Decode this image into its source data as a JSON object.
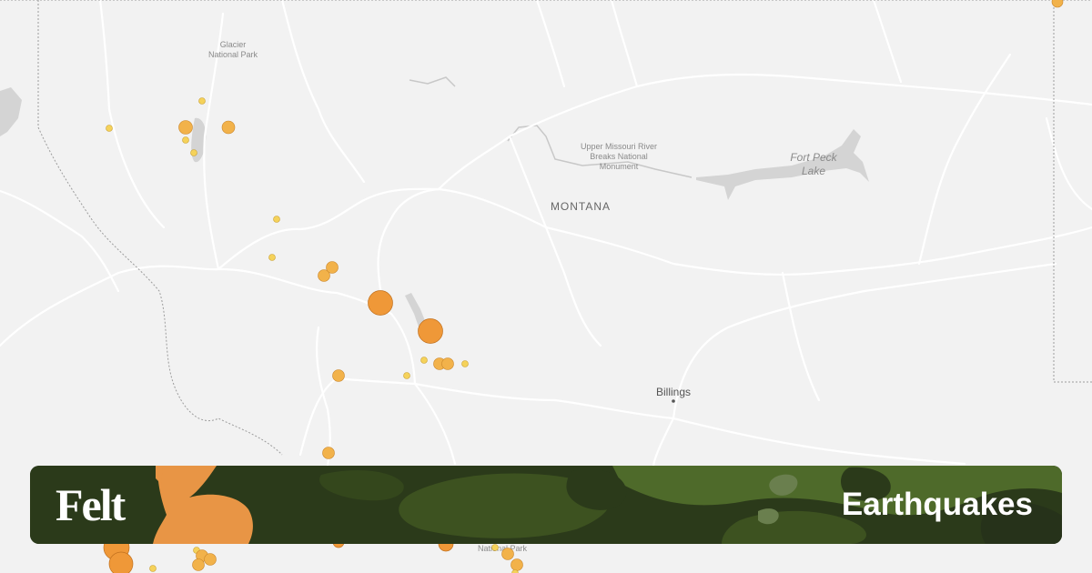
{
  "map": {
    "labels": {
      "glacier": [
        "Glacier",
        "National Park"
      ],
      "missouri": [
        "Upper Missouri River",
        "Breaks National",
        "Monument"
      ],
      "fort_peck": [
        "Fort Peck",
        "Lake"
      ],
      "state": "MONTANA",
      "billings": "Billings",
      "yellowstone": "National Park"
    },
    "colors": {
      "background": "#f2f2f2",
      "roads": "#ffffff",
      "water": "#cfcfcf",
      "borders": "#9a9a9a",
      "quake_small": "#f5d25a",
      "quake_medium": "#f2b24a",
      "quake_large": "#ef9838"
    }
  },
  "earthquakes": [
    {
      "mag": "small"
    },
    {
      "mag": "small"
    },
    {
      "mag": "medium"
    },
    {
      "mag": "small"
    },
    {
      "mag": "small"
    },
    {
      "mag": "medium"
    },
    {
      "mag": "small"
    },
    {
      "mag": "small"
    },
    {
      "mag": "medium"
    },
    {
      "mag": "medium"
    },
    {
      "mag": "large"
    },
    {
      "mag": "large"
    },
    {
      "mag": "small"
    },
    {
      "mag": "medium"
    },
    {
      "mag": "medium"
    },
    {
      "mag": "small"
    },
    {
      "mag": "medium"
    },
    {
      "mag": "small"
    },
    {
      "mag": "medium"
    },
    {
      "mag": "large"
    }
  ],
  "banner": {
    "logo": "Felt",
    "title": "Earthquakes",
    "colors": {
      "base": "#2b3a1a",
      "mid": "#3d5220",
      "light": "#4e6a2a",
      "orange": "#e89545"
    }
  }
}
